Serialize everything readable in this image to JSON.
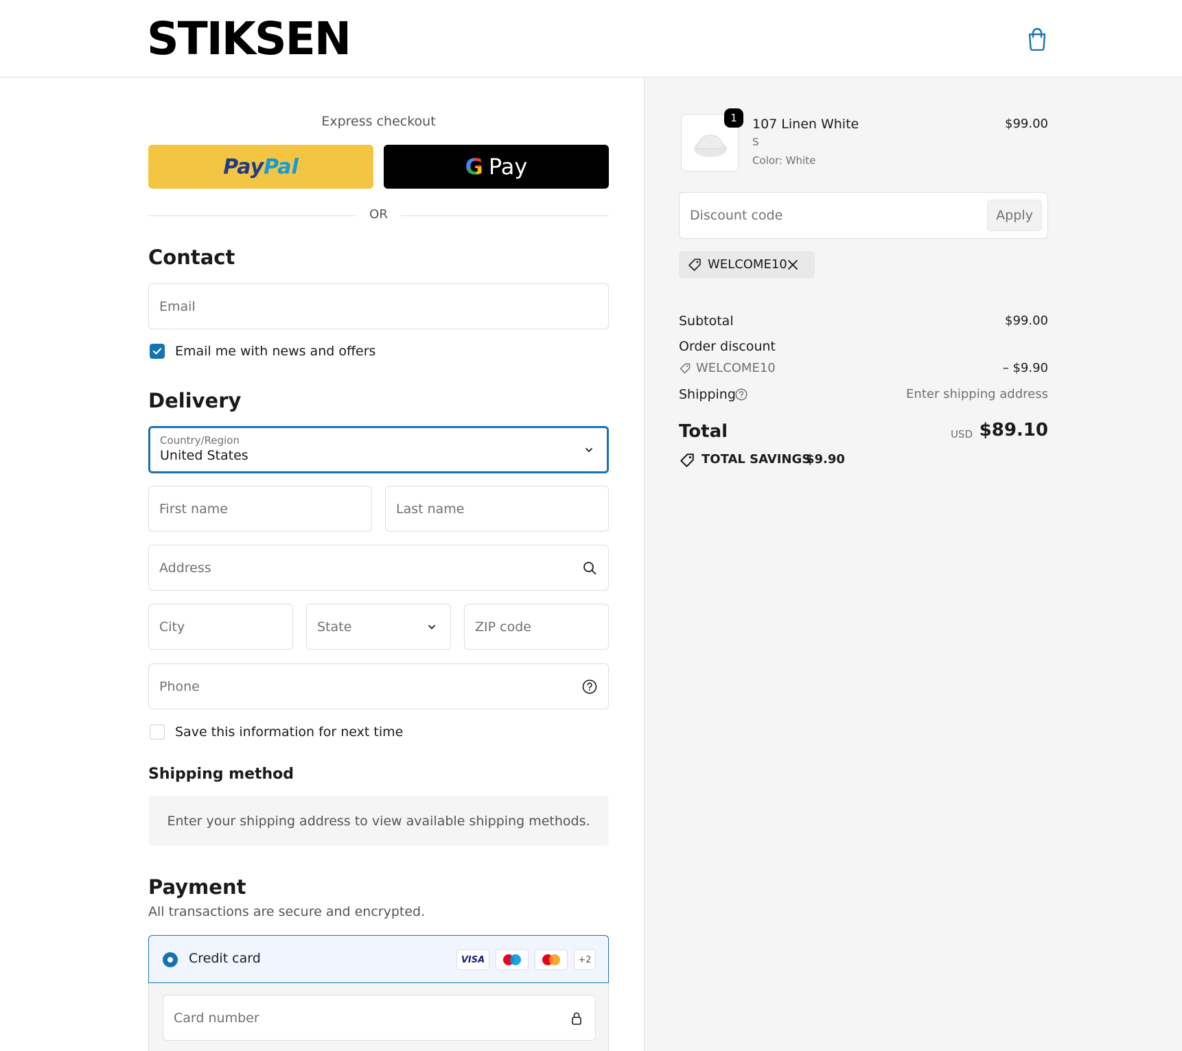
{
  "header": {
    "logo": "STIKSEN",
    "cart_icon": "shopping-bag-icon"
  },
  "express": {
    "label": "Express checkout",
    "paypal_part1": "Pay",
    "paypal_part2": "Pal",
    "gpay_g": "G",
    "gpay_label": "Pay",
    "or": "OR"
  },
  "contact": {
    "title": "Contact",
    "email_placeholder": "Email",
    "news_label": "Email me with news and offers",
    "news_checked": true
  },
  "delivery": {
    "title": "Delivery",
    "country_label": "Country/Region",
    "country_value": "United States",
    "first_name": "First name",
    "last_name": "Last name",
    "address": "Address",
    "city": "City",
    "state": "State",
    "zip": "ZIP code",
    "phone": "Phone",
    "save_label": "Save this information for next time",
    "save_checked": false
  },
  "shipping": {
    "title": "Shipping method",
    "message": "Enter your shipping address to view available shipping methods."
  },
  "payment": {
    "title": "Payment",
    "subtitle": "All transactions are secure and encrypted.",
    "method": "Credit card",
    "cards": [
      "VISA",
      "+2"
    ],
    "card_number": "Card number"
  },
  "summary": {
    "item": {
      "name": "107 Linen White",
      "variant": "S",
      "color": "Color: White",
      "price": "$99.00",
      "qty": "1"
    },
    "discount_placeholder": "Discount code",
    "apply": "Apply",
    "applied_code": "WELCOME10",
    "subtotal_label": "Subtotal",
    "subtotal_value": "$99.00",
    "order_discount_label": "Order discount",
    "discount_code": "WELCOME10",
    "discount_value": "– $9.90",
    "shipping_label": "Shipping",
    "shipping_value": "Enter shipping address",
    "total_label": "Total",
    "currency": "USD",
    "total_value": "$89.10",
    "savings_label": "TOTAL SAVINGS",
    "savings_value": "$9.90"
  },
  "colors": {
    "accent": "#1773b0",
    "paypal_yellow": "#f4c542",
    "sidebar_bg": "#f5f5f5"
  }
}
